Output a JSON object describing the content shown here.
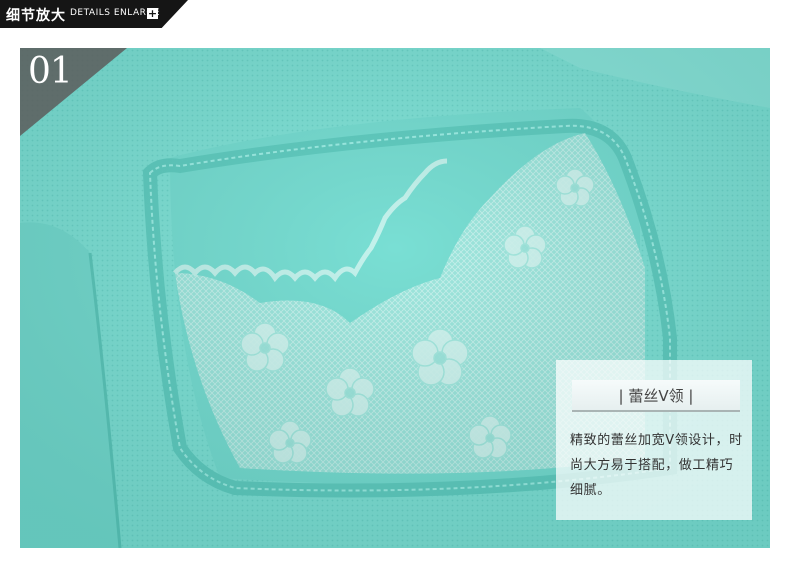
{
  "header": {
    "title_cn": "细节放大",
    "title_en": "DETAILS ENLARGE",
    "plus_symbol": "+"
  },
  "badge": {
    "number": "01"
  },
  "info": {
    "title": "| 蕾丝V领 |",
    "description": "精致的蕾丝加宽V领设计，时尚大方易于搭配，做工精巧细腻。"
  },
  "colors": {
    "header_bg": "#151515",
    "fabric": "#7fe3d8",
    "lace": "#b8efe8",
    "badge_bg": "#5c5c5c"
  }
}
